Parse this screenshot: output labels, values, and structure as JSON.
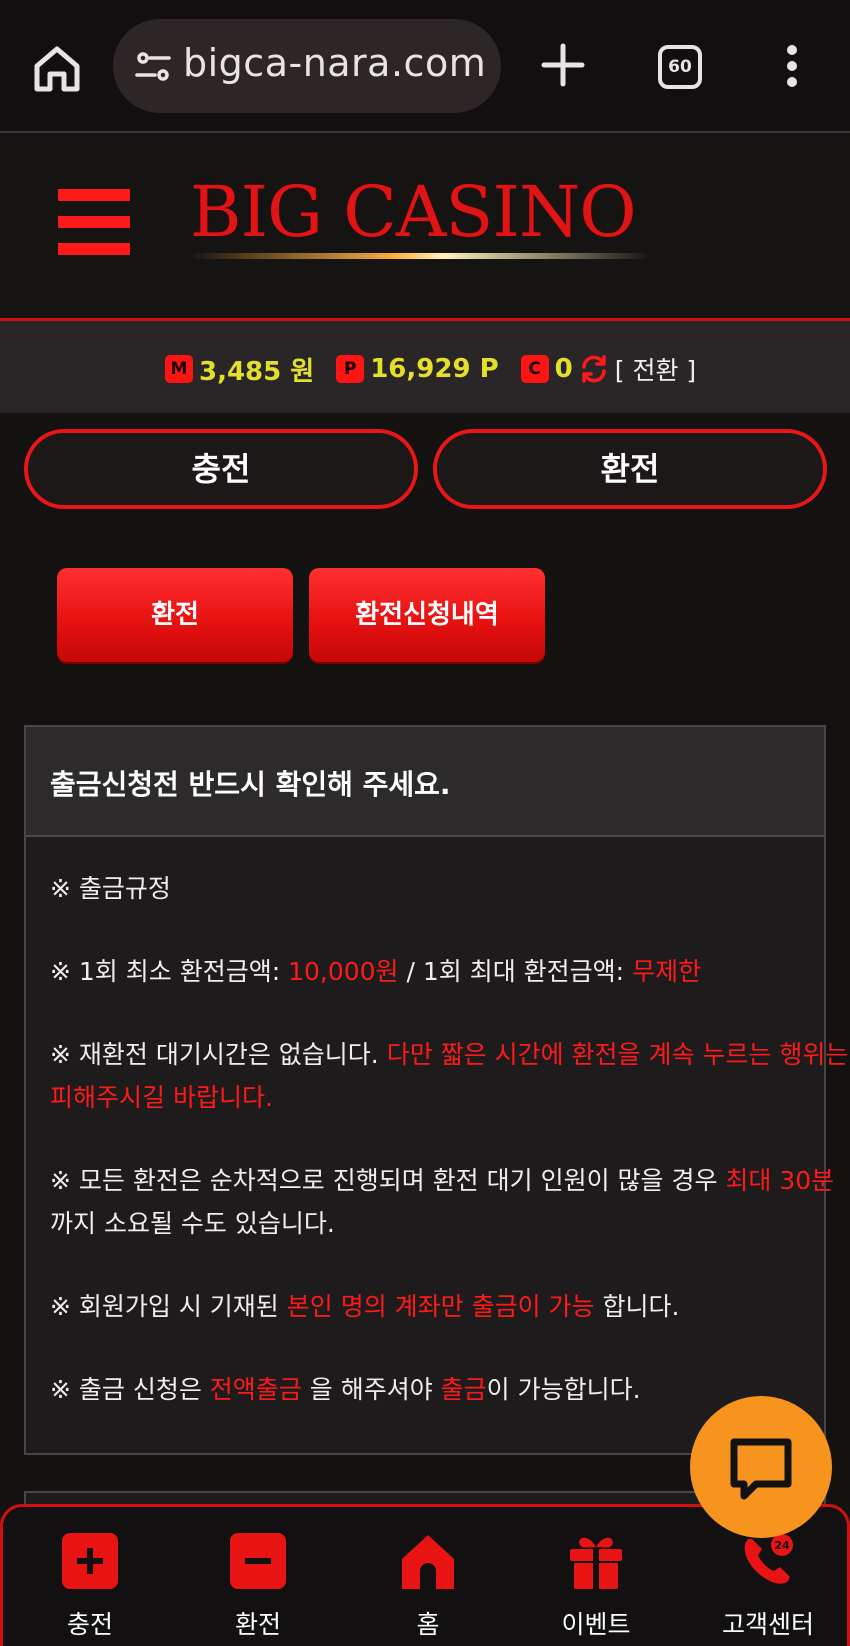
{
  "browser": {
    "url": "bigca-nara.com",
    "tab_count": "60"
  },
  "site": {
    "logo_text": "BIG CASINO"
  },
  "balance": {
    "money_badge": "M",
    "money_value": "3,485 원",
    "point_badge": "P",
    "point_value": "16,929 P",
    "coin_badge": "C",
    "coin_value": "0",
    "switch_label": "[ 전환 ]"
  },
  "tabs": {
    "charge": "충전",
    "exchange": "환전"
  },
  "sub_tabs": {
    "exchange": "환전",
    "history": "환전신청내역"
  },
  "notice": {
    "title": "출금신청전 반드시 확인해 주세요.",
    "l1": "※ 출금규정",
    "l2a": "※ 1회 최소 환전금액: ",
    "l2b": "10,000원",
    "l2c": " / 1회 최대 환전금액: ",
    "l2d": "무제한",
    "l3a": "※ 재환전 대기시간은 없습니다. ",
    "l3b": "다만 짧은 시간에 환전을 계속 누르는 행위는 피해주시길 바랍니다.",
    "l4a": "※ 모든 환전은 순차적으로 진행되며 환전 대기 인원이 많을 경우 ",
    "l4b": "최대 30분",
    "l4c": " 까지 소요될 수도 있습니다.",
    "l5a": "※ 회원가입 시 기재된 ",
    "l5b": "본인 명의 계좌만 출금이 가능",
    "l5c": " 합니다.",
    "l6a": "※ 출금 신청은 ",
    "l6b": "전액출금",
    "l6c": " 을 해주셔야 ",
    "l6d": "출금",
    "l6e": "이 가능합니다."
  },
  "bottom_nav": {
    "charge": "충전",
    "exchange": "환전",
    "home": "홈",
    "event": "이벤트",
    "support": "고객센터",
    "support_badge": "24"
  },
  "colors": {
    "accent_red": "#ff1a1a",
    "balance_yellow": "#e4e02a",
    "chat_orange": "#f7941d"
  }
}
